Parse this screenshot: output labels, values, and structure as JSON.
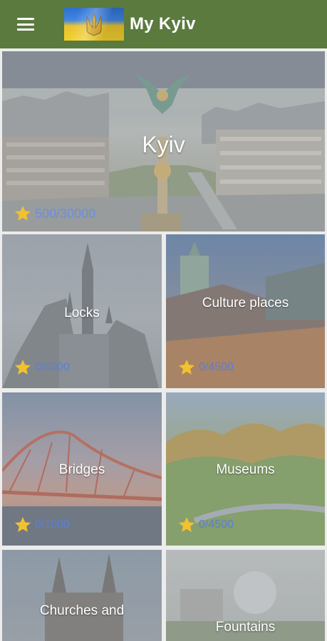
{
  "app_bar": {
    "title": "My Kyiv",
    "menu_icon": "hamburger-menu-icon",
    "logo_icon": "ukraine-flag-trident-icon",
    "background": "#5a7a3e"
  },
  "hero": {
    "title": "Kyiv",
    "score": "500/30000"
  },
  "categories": [
    {
      "label": "Locks",
      "score": "0/6000"
    },
    {
      "label": "Culture places",
      "score": "0/4500"
    },
    {
      "label": "Bridges",
      "score": "0/1000"
    },
    {
      "label": "Museums",
      "score": "0/4500"
    },
    {
      "label": "Churches and",
      "score": ""
    },
    {
      "label": "Fountains",
      "score": ""
    }
  ],
  "colors": {
    "star": "#f2c12e",
    "score_text": "#5b7fd2"
  }
}
